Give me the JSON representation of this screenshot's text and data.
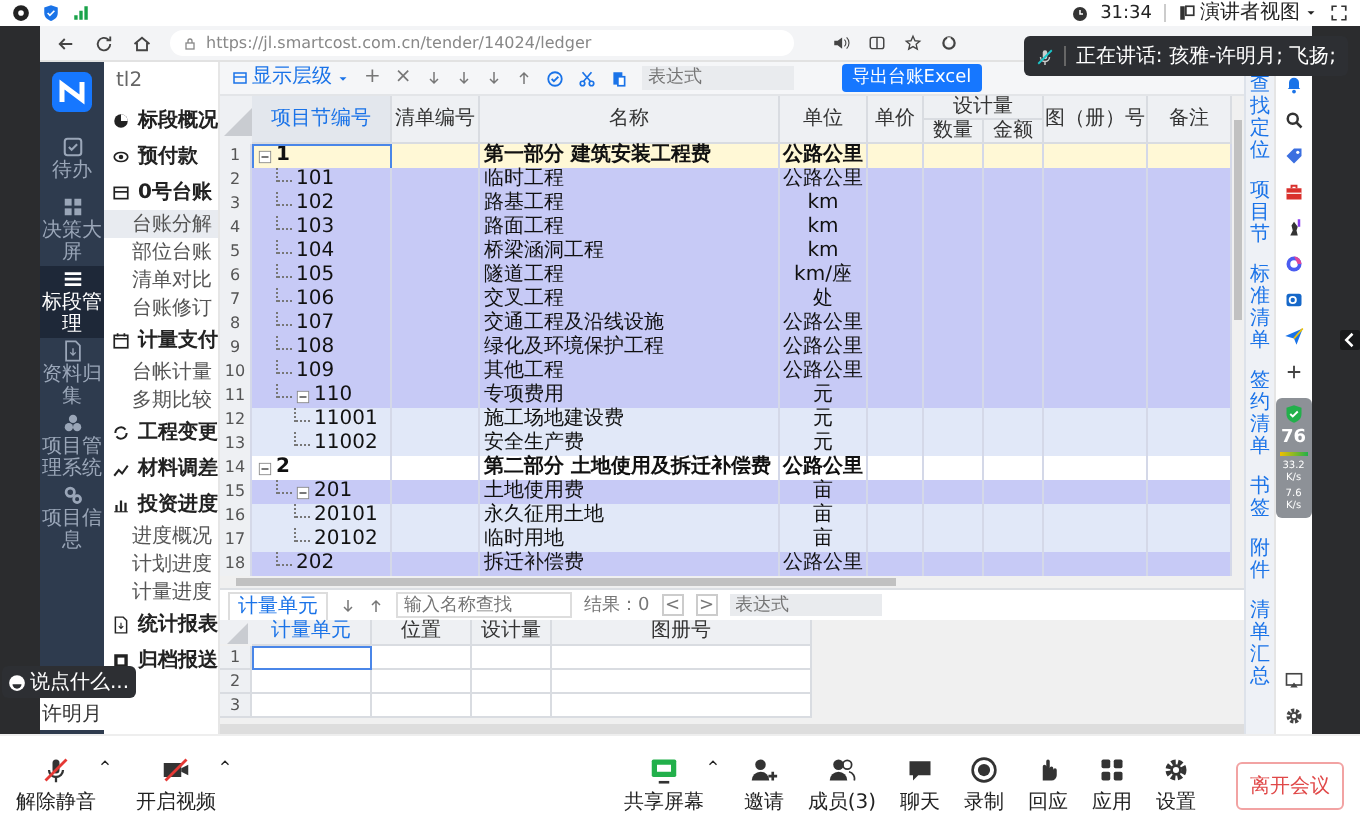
{
  "status_bar": {
    "time": "31:34",
    "presenter_view": "演讲者视图"
  },
  "browser": {
    "url": "https://jl.smartcost.com.cn/tender/14024/ledger"
  },
  "speaking_notice": "正在讲话: 孩雅-许明月; 飞扬;",
  "nav": {
    "items": [
      {
        "label": "待办",
        "selected": false
      },
      {
        "label": "决策大屏",
        "selected": false
      },
      {
        "label": "标段管理",
        "selected": true
      },
      {
        "label": "资料归集",
        "selected": false
      },
      {
        "label": "项目管理系统",
        "selected": false
      },
      {
        "label": "项目信息",
        "selected": false
      }
    ],
    "user": "许明月"
  },
  "menu": {
    "tender": "tl2",
    "groups": [
      {
        "label": "标段概况"
      },
      {
        "label": "预付款"
      },
      {
        "label": "0号台账",
        "items": [
          {
            "label": "台账分解",
            "selected": true
          },
          {
            "label": "部位台账",
            "selected": false
          },
          {
            "label": "清单对比",
            "selected": false
          },
          {
            "label": "台账修订",
            "selected": false
          }
        ]
      },
      {
        "label": "计量支付",
        "items": [
          {
            "label": "台帐计量",
            "selected": false
          },
          {
            "label": "多期比较",
            "selected": false
          }
        ]
      },
      {
        "label": "工程变更"
      },
      {
        "label": "材料调差"
      },
      {
        "label": "投资进度",
        "items": [
          {
            "label": "进度概况",
            "selected": false
          },
          {
            "label": "计划进度",
            "selected": false
          },
          {
            "label": "计量进度",
            "selected": false
          }
        ]
      },
      {
        "label": "统计报表"
      },
      {
        "label": "归档报送"
      }
    ]
  },
  "toolbar": {
    "level_menu": "显示层级",
    "actions": [
      "+",
      "×"
    ],
    "expression": {
      "placeholder": "表达式"
    },
    "export": "导出台账Excel"
  },
  "ledger": {
    "columns": [
      {
        "label": "项目节编号",
        "selected": true
      },
      {
        "label": "清单编号",
        "selected": false
      },
      {
        "label": "名称",
        "selected": false
      },
      {
        "label": "单位",
        "selected": false
      },
      {
        "label": "单价",
        "selected": false
      },
      {
        "label": "设计量",
        "selected": false,
        "children": [
          {
            "label": "数量"
          },
          {
            "label": "金额"
          }
        ]
      },
      {
        "label": "图（册）号",
        "selected": false
      },
      {
        "label": "备注",
        "selected": false
      }
    ],
    "rows": [
      {
        "row_number": "1",
        "code": "1",
        "name": "第一部分 建筑安装工程费",
        "unit": "公路公里",
        "expanded": true,
        "selected": true,
        "children": [
          {
            "row_number": "2",
            "code": "101",
            "name": "临时工程",
            "unit": "公路公里",
            "selected": false
          },
          {
            "row_number": "3",
            "code": "102",
            "name": "路基工程",
            "unit": "km",
            "selected": false
          },
          {
            "row_number": "4",
            "code": "103",
            "name": "路面工程",
            "unit": "km",
            "selected": false
          },
          {
            "row_number": "5",
            "code": "104",
            "name": "桥梁涵洞工程",
            "unit": "km",
            "selected": false
          },
          {
            "row_number": "6",
            "code": "105",
            "name": "隧道工程",
            "unit": "km/座",
            "selected": false
          },
          {
            "row_number": "7",
            "code": "106",
            "name": "交叉工程",
            "unit": "处",
            "selected": false
          },
          {
            "row_number": "8",
            "code": "107",
            "name": "交通工程及沿线设施",
            "unit": "公路公里",
            "selected": false
          },
          {
            "row_number": "9",
            "code": "108",
            "name": "绿化及环境保护工程",
            "unit": "公路公里",
            "selected": false
          },
          {
            "row_number": "10",
            "code": "109",
            "name": "其他工程",
            "unit": "公路公里",
            "selected": false
          },
          {
            "row_number": "11",
            "code": "110",
            "name": "专项费用",
            "unit": "元",
            "expanded": true,
            "selected": false,
            "children": [
              {
                "row_number": "12",
                "code": "11001",
                "name": "施工场地建设费",
                "unit": "元",
                "selected": false
              },
              {
                "row_number": "13",
                "code": "11002",
                "name": "安全生产费",
                "unit": "元",
                "selected": false
              }
            ]
          }
        ]
      },
      {
        "row_number": "14",
        "code": "2",
        "name": "第二部分 土地使用及拆迁补偿费",
        "unit": "公路公里",
        "expanded": true,
        "selected": false,
        "children": [
          {
            "row_number": "15",
            "code": "201",
            "name": "土地使用费",
            "unit": "亩",
            "expanded": true,
            "selected": false,
            "children": [
              {
                "row_number": "16",
                "code": "20101",
                "name": "永久征用土地",
                "unit": "亩",
                "selected": false
              },
              {
                "row_number": "17",
                "code": "20102",
                "name": "临时用地",
                "unit": "亩",
                "selected": false
              }
            ]
          },
          {
            "row_number": "18",
            "code": "202",
            "name": "拆迁补偿费",
            "unit": "公路公里",
            "selected": false
          }
        ]
      }
    ]
  },
  "unit_panel": {
    "tab": {
      "label": "计量单元",
      "selected": true
    },
    "search": {
      "placeholder": "输入名称查找"
    },
    "result": "结果：0",
    "prev": "<",
    "next": ">",
    "expression": {
      "placeholder": "表达式"
    },
    "columns": [
      {
        "label": "计量单元",
        "selected": true
      },
      {
        "label": "位置",
        "selected": false
      },
      {
        "label": "设计量",
        "selected": false
      },
      {
        "label": "图册号",
        "selected": false
      }
    ],
    "rows": [
      {
        "row_number": "1",
        "selected": true
      },
      {
        "row_number": "2",
        "selected": false
      },
      {
        "row_number": "3",
        "selected": false
      }
    ]
  },
  "side_links": [
    "查找定位",
    "项目节",
    "标准清单",
    "签约清单",
    "书签",
    "附件",
    "清单汇总"
  ],
  "browser_sidebar": {
    "score": "76",
    "upload": "33.2 K/s",
    "download": "7.6 K/s"
  },
  "chat_prompt": "说点什么...",
  "meeting_bar": {
    "left": [
      {
        "kind": "mic_off",
        "label": "解除静音"
      },
      {
        "kind": "video_off",
        "label": "开启视频"
      }
    ],
    "right": [
      {
        "kind": "share",
        "label": "共享屏幕"
      },
      {
        "kind": "invite",
        "label": "邀请"
      },
      {
        "kind": "members",
        "label": "成员(3)"
      },
      {
        "kind": "chat",
        "label": "聊天"
      },
      {
        "kind": "record",
        "label": "录制"
      },
      {
        "kind": "react",
        "label": "回应"
      },
      {
        "kind": "apps",
        "label": "应用"
      },
      {
        "kind": "settings",
        "label": "设置"
      }
    ],
    "leave": "离开会议"
  }
}
